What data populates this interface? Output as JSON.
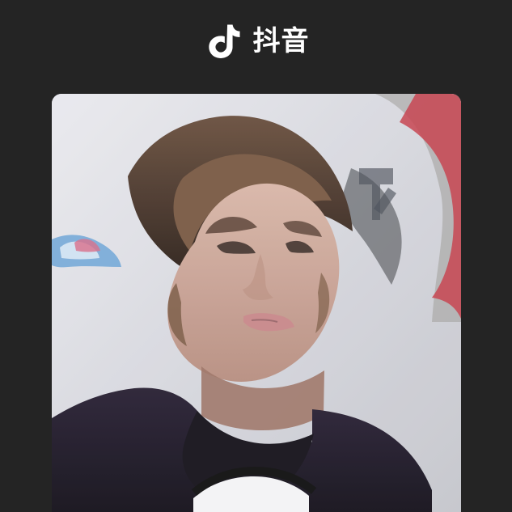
{
  "header": {
    "app_name": "抖音",
    "logo_icon": "tiktok-note-icon"
  },
  "card": {
    "image_icon": "portrait-photo",
    "colors": {
      "background": "#242424",
      "text": "#ffffff"
    }
  }
}
